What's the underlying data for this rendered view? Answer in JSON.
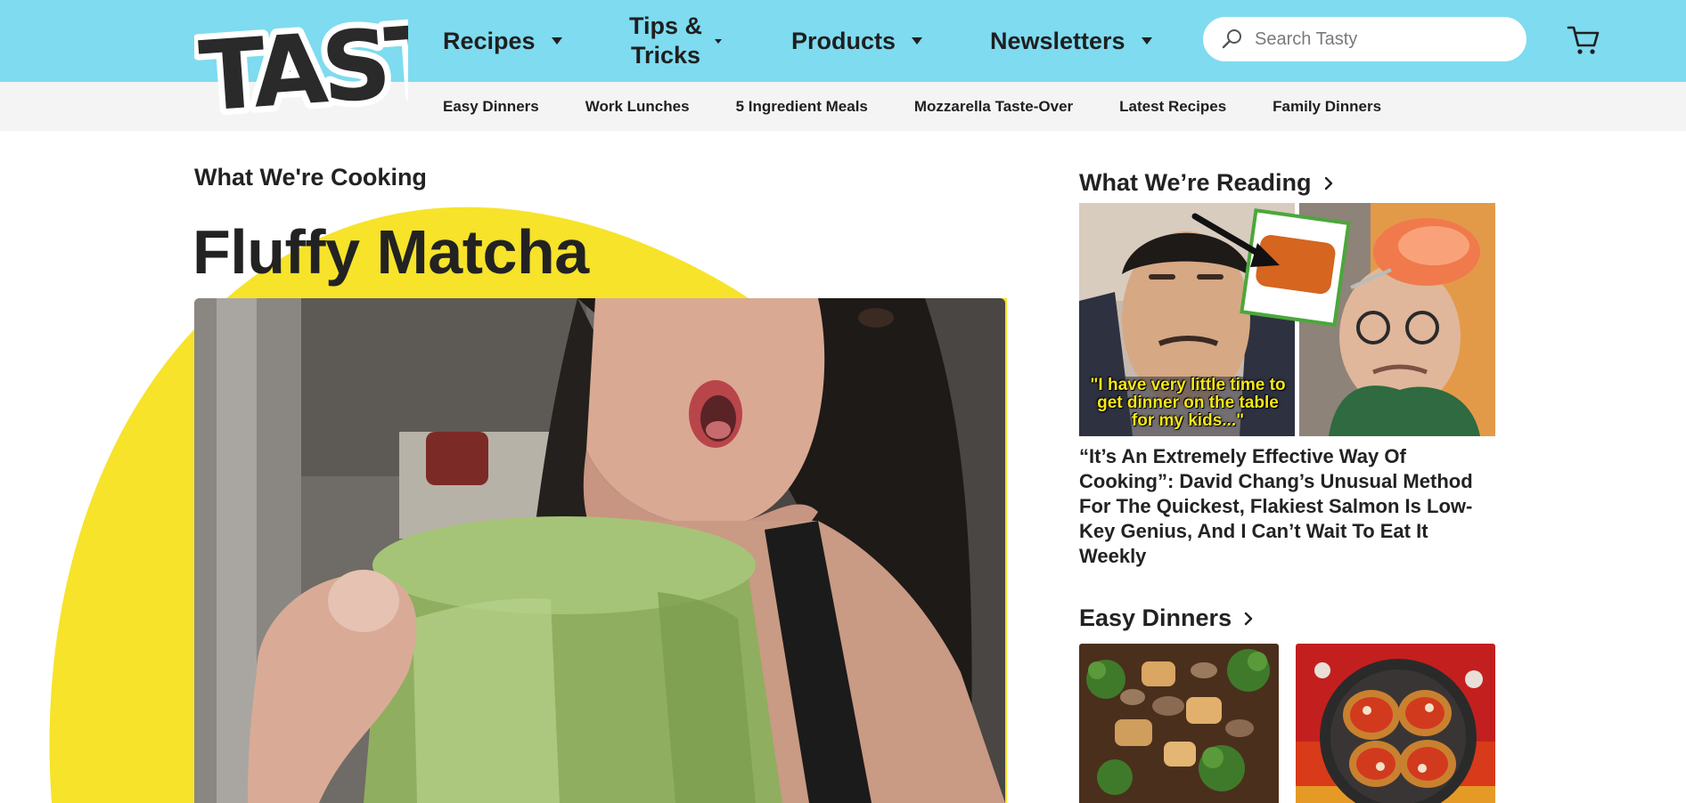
{
  "brand": {
    "logo_text": "TASTY"
  },
  "header": {
    "nav": [
      {
        "label": "Recipes"
      },
      {
        "label": "Tips &",
        "label2": "Tricks"
      },
      {
        "label": "Products"
      },
      {
        "label": "Newsletters"
      }
    ],
    "search": {
      "placeholder": "Search Tasty"
    }
  },
  "subnav": {
    "items": [
      {
        "label": "Easy Dinners"
      },
      {
        "label": "Work Lunches"
      },
      {
        "label": "5 Ingredient Meals"
      },
      {
        "label": "Mozzarella Taste-Over"
      },
      {
        "label": "Latest Recipes"
      },
      {
        "label": "Family Dinners"
      }
    ]
  },
  "main": {
    "section_label": "What We're Cooking",
    "feature_title": "Fluffy Matcha"
  },
  "sidebar": {
    "reading_heading": "What We’re Reading",
    "reading_caption": "\"I have very little time to get dinner on the table for my kids...\"",
    "article_title": "“It’s An Extremely Effective Way Of Cooking”: David Chang’s Unusual Method For The Quickest, Flakiest Salmon Is Low-Key Genius, And I Can’t Wait To Eat It Weekly",
    "dinners_heading": "Easy Dinners"
  },
  "colors": {
    "header_bg": "#7edbf0",
    "subnav_bg": "#f4f4f4",
    "accent_yellow": "#f7e32a",
    "text_dark": "#222222"
  },
  "icons": {
    "search": "search-icon",
    "cart": "cart-icon",
    "caret": "caret-down-icon",
    "chevron": "chevron-right-icon"
  }
}
